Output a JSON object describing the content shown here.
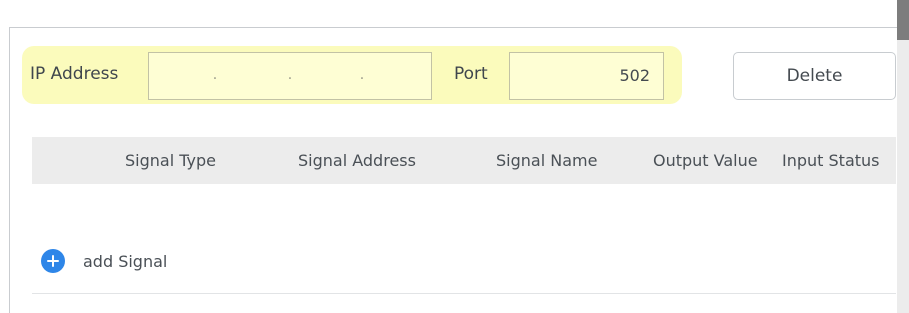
{
  "connection": {
    "ip_label": "IP Address",
    "ip_value": "",
    "ip_dots": [
      ".",
      ".",
      "."
    ],
    "port_label": "Port",
    "port_value": "502",
    "delete_label": "Delete"
  },
  "table": {
    "columns": [
      "Signal Type",
      "Signal Address",
      "Signal Name",
      "Output Value",
      "Input Status"
    ],
    "rows": []
  },
  "actions": {
    "add_signal_label": "add Signal",
    "add_icon": "plus-circle-icon"
  },
  "colors": {
    "highlight": "#fbfbbc",
    "field_bg": "#fefed4",
    "accent": "#2e86e8",
    "header_bg": "#ececec"
  }
}
